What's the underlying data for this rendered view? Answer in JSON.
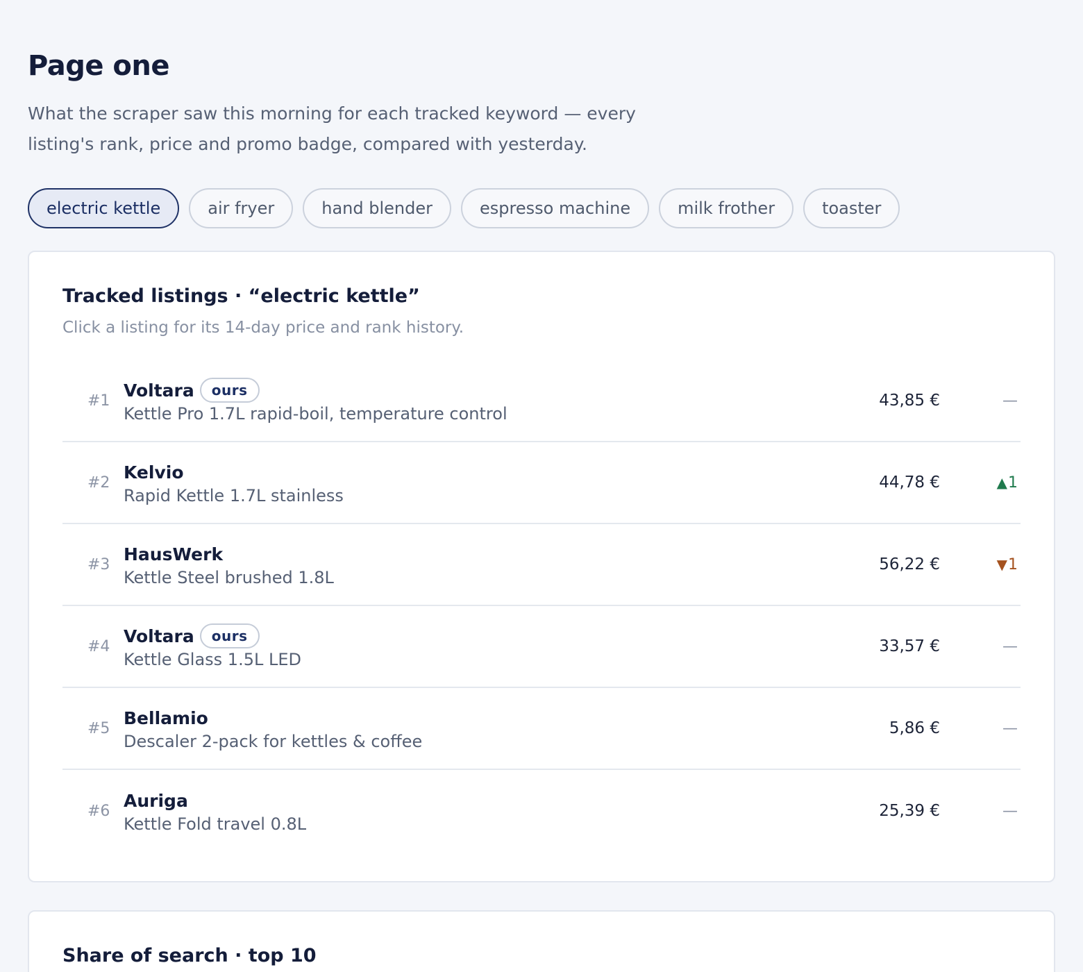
{
  "header": {
    "title": "Page one",
    "subtitle": "What the scraper saw this morning for each tracked keyword — every listing's rank, price and promo badge, compared with yesterday."
  },
  "keywords": [
    {
      "label": "electric kettle",
      "active": true
    },
    {
      "label": "air fryer",
      "active": false
    },
    {
      "label": "hand blender",
      "active": false
    },
    {
      "label": "espresso machine",
      "active": false
    },
    {
      "label": "milk frother",
      "active": false
    },
    {
      "label": "toaster",
      "active": false
    }
  ],
  "tracked": {
    "title": "Tracked listings · “electric kettle”",
    "hint": "Click a listing for its 14-day price and rank history.",
    "listings": [
      {
        "rank": "#1",
        "brand": "Voltara",
        "badge": "ours",
        "product": "Kettle Pro 1.7L rapid-boil, temperature control",
        "price": "43,85 €",
        "delta": "—",
        "delta_dir": "none"
      },
      {
        "rank": "#2",
        "brand": "Kelvio",
        "badge": "",
        "product": "Rapid Kettle 1.7L stainless",
        "price": "44,78 €",
        "delta": "1",
        "delta_dir": "up"
      },
      {
        "rank": "#3",
        "brand": "HausWerk",
        "badge": "",
        "product": "Kettle Steel brushed 1.8L",
        "price": "56,22 €",
        "delta": "1",
        "delta_dir": "down"
      },
      {
        "rank": "#4",
        "brand": "Voltara",
        "badge": "ours",
        "product": "Kettle Glass 1.5L LED",
        "price": "33,57 €",
        "delta": "—",
        "delta_dir": "none"
      },
      {
        "rank": "#5",
        "brand": "Bellamio",
        "badge": "",
        "product": "Descaler 2-pack for kettles & coffee",
        "price": "5,86 €",
        "delta": "—",
        "delta_dir": "none"
      },
      {
        "rank": "#6",
        "brand": "Auriga",
        "badge": "",
        "product": "Kettle Fold travel 0.8L",
        "price": "25,39 €",
        "delta": "—",
        "delta_dir": "none"
      }
    ]
  },
  "share": {
    "title": "Share of search · top 10"
  },
  "icons": {
    "up": "triangle-up-icon",
    "down": "triangle-down-icon"
  },
  "colors": {
    "accent": "#1c2f64",
    "up": "#1f7a4d",
    "down": "#a5521f"
  }
}
